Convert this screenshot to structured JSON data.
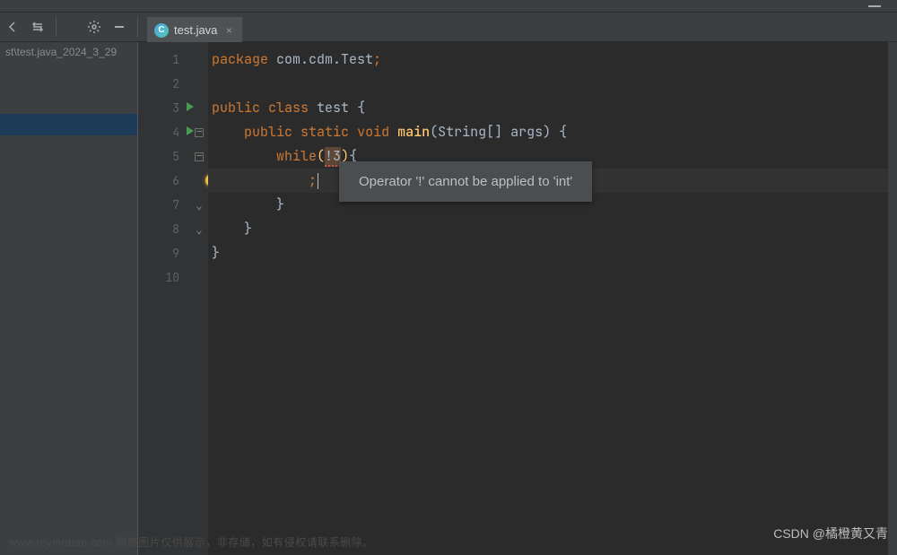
{
  "topbar": {},
  "toolbar": {
    "icons": [
      "go-back-icon",
      "refresh-icon",
      "minus-icon",
      "gear-icon",
      "minimize-icon"
    ]
  },
  "tab": {
    "label": "test.java"
  },
  "left_panel": {
    "path_fragment": "st\\test.java_2024_3_29"
  },
  "gutter": {
    "lines": [
      "1",
      "2",
      "3",
      "4",
      "5",
      "6",
      "7",
      "8",
      "9",
      "10"
    ]
  },
  "code": {
    "l1": {
      "kw": "package",
      "rest": " com.cdm.Test",
      "semi": ";"
    },
    "l2": "",
    "l3": {
      "kw1": "public",
      "kw2": "class",
      "name": " test ",
      "brace": "{"
    },
    "l4": {
      "indent": "    ",
      "kw1": "public",
      "kw2": "static",
      "kw3": "void",
      "fn": "main",
      "args": "(String[] args) {"
    },
    "l5": {
      "indent": "        ",
      "kw": "while",
      "open": "(",
      "err": "!3",
      "close": ")",
      "brace": "{"
    },
    "l6": {
      "indent": "            ",
      "semi": ";"
    },
    "l7": {
      "indent": "        ",
      "brace": "}"
    },
    "l8": {
      "indent": "    ",
      "brace": "}"
    },
    "l9": {
      "brace": "}"
    }
  },
  "tooltip": {
    "text": "Operator '!' cannot be applied to 'int'"
  },
  "watermarks": {
    "left": "www.toymoban.com 网络图片仅供展示，非存储，如有侵权请联系删除。",
    "right": "CSDN @橘橙黄又青"
  }
}
